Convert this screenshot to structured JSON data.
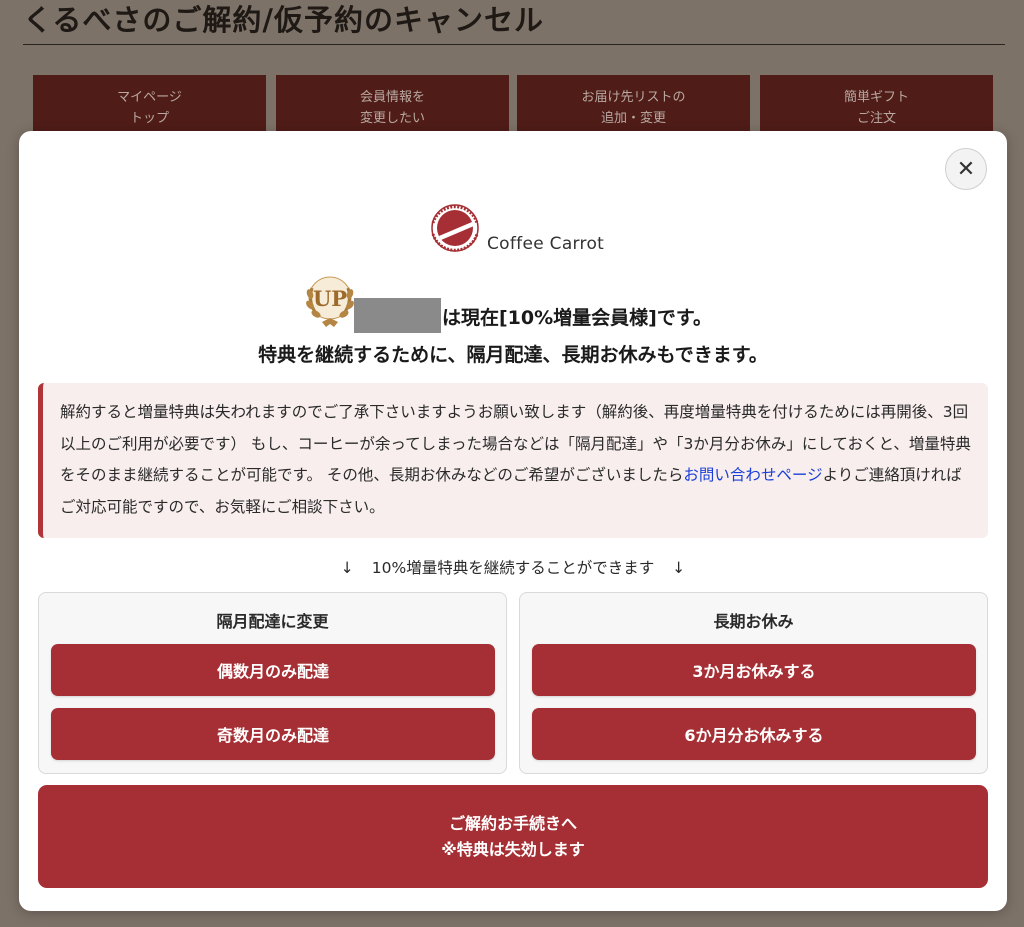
{
  "page": {
    "title": "くるべさのご解約/仮予約のキャンセル"
  },
  "nav": [
    {
      "line1": "マイページ",
      "line2": "トップ"
    },
    {
      "line1": "会員情報を",
      "line2": "変更したい"
    },
    {
      "line1": "お届け先リストの",
      "line2": "追加・変更"
    },
    {
      "line1": "簡単ギフト",
      "line2": "ご注文"
    }
  ],
  "modal": {
    "close_label": "✕",
    "brand_name": "Coffee Carrot",
    "badge_text": "UP",
    "member_status": "は現在[10%増量会員様]です。",
    "tagline": "特典を継続するために、隔月配達、長期お休みもできます。",
    "notice": {
      "text_before_link": "解約すると増量特典は失われますのでご了承下さいますようお願い致します（解約後、再度増量特典を付けるためには再開後、3回以上のご利用が必要です） もし、コーヒーが余ってしまった場合などは「隔月配達」や「3か月分お休み」にしておくと、増量特典をそのまま継続することが可能です。 その他、長期お休みなどのご希望がございましたら",
      "link_text": "お問い合わせページ",
      "text_after_link": "よりご連絡頂ければご対応可能ですので、お気軽にご相談下さい。"
    },
    "continue_note": {
      "arrow_left": "↓",
      "text": "10%増量特典を継続することができます",
      "arrow_right": "↓"
    },
    "bimonthly": {
      "title": "隔月配達に変更",
      "even_label": "偶数月のみ配達",
      "odd_label": "奇数月のみ配達"
    },
    "long_break": {
      "title": "長期お休み",
      "three_month_label": "3か月お休みする",
      "six_month_label": "6か月分お休みする"
    },
    "cancel": {
      "line1": "ご解約お手続きへ",
      "line2": "※特典は失効します"
    }
  },
  "colors": {
    "brand_red": "#a52f34",
    "notice_border": "#b13538",
    "notice_bg": "#f8eeee",
    "link": "#1a3fd6",
    "overlay_bg": "#7d7268"
  },
  "icons": {
    "brand_logo": "coffee-carrot-logo",
    "badge": "laurel-up-badge",
    "close": "close-icon"
  }
}
